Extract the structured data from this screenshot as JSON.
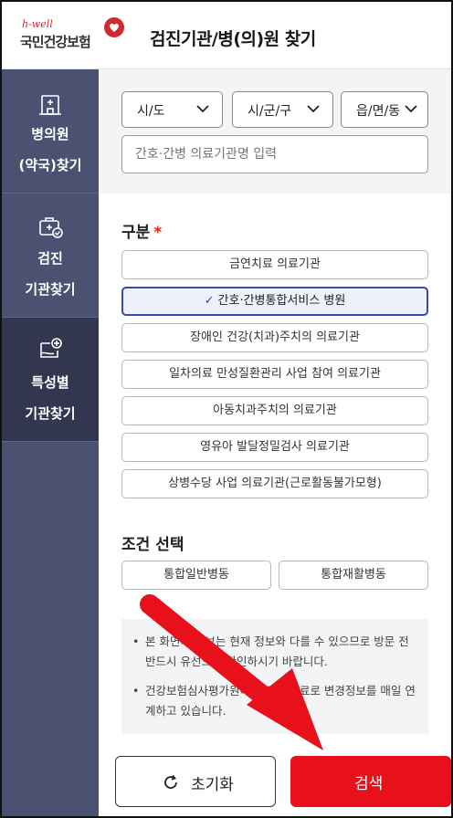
{
  "header": {
    "logo_small": "h-well",
    "logo_text": "국민건강보험",
    "title": "검진기관/병(의)원 찾기",
    "logo_color": "#d4282f"
  },
  "sidebar": {
    "items": [
      {
        "label_1": "병의원",
        "label_2": "(약국)찾기",
        "icon": "hospital-building-icon",
        "active": false
      },
      {
        "label_1": "검진",
        "label_2": "기관찾기",
        "icon": "medical-bag-check-icon",
        "active": false
      },
      {
        "label_1": "특성별",
        "label_2": "기관찾기",
        "icon": "special-plus-icon",
        "active": true
      }
    ],
    "bg_color": "#4b5170",
    "active_color": "#32364f"
  },
  "filters": {
    "sido": "시/도",
    "sigungu": "시/군/구",
    "eupmyeondong": "읍/면/동",
    "search_placeholder": "간호·간병 의료기관명 입력"
  },
  "category": {
    "title": "구분",
    "required_mark": "*",
    "options": [
      {
        "label": "금연치료 의료기관",
        "selected": false
      },
      {
        "label": "간호·간병통합서비스 병원",
        "selected": true
      },
      {
        "label": "장애인 건강(치과)주치의 의료기관",
        "selected": false
      },
      {
        "label": "일차의료 만성질환관리 사업 참여 의료기관",
        "selected": false
      },
      {
        "label": "아동치과주치의 의료기관",
        "selected": false
      },
      {
        "label": "영유아 발달정밀검사 의료기관",
        "selected": false
      },
      {
        "label": "상병수당 사업 의료기관(근로활동불가모형)",
        "selected": false
      }
    ],
    "check_mark": "✓"
  },
  "conditions": {
    "title": "조건 선택",
    "options": [
      "통합일반병동",
      "통합재활병동"
    ]
  },
  "notice": {
    "items": [
      "본 화면의 정보는 현재 정보와 다를 수 있으므로 방문 전 반드시 유선으로 확인하시기 바랍니다.",
      "건강보험심사평가원에 신고된 자료로 변경정보를 매일 연계하고 있습니다."
    ]
  },
  "actions": {
    "reset_label": "초기화",
    "search_label": "검색",
    "search_color": "#e8101a"
  },
  "overlay": {
    "arrow_color": "#e8101a"
  }
}
